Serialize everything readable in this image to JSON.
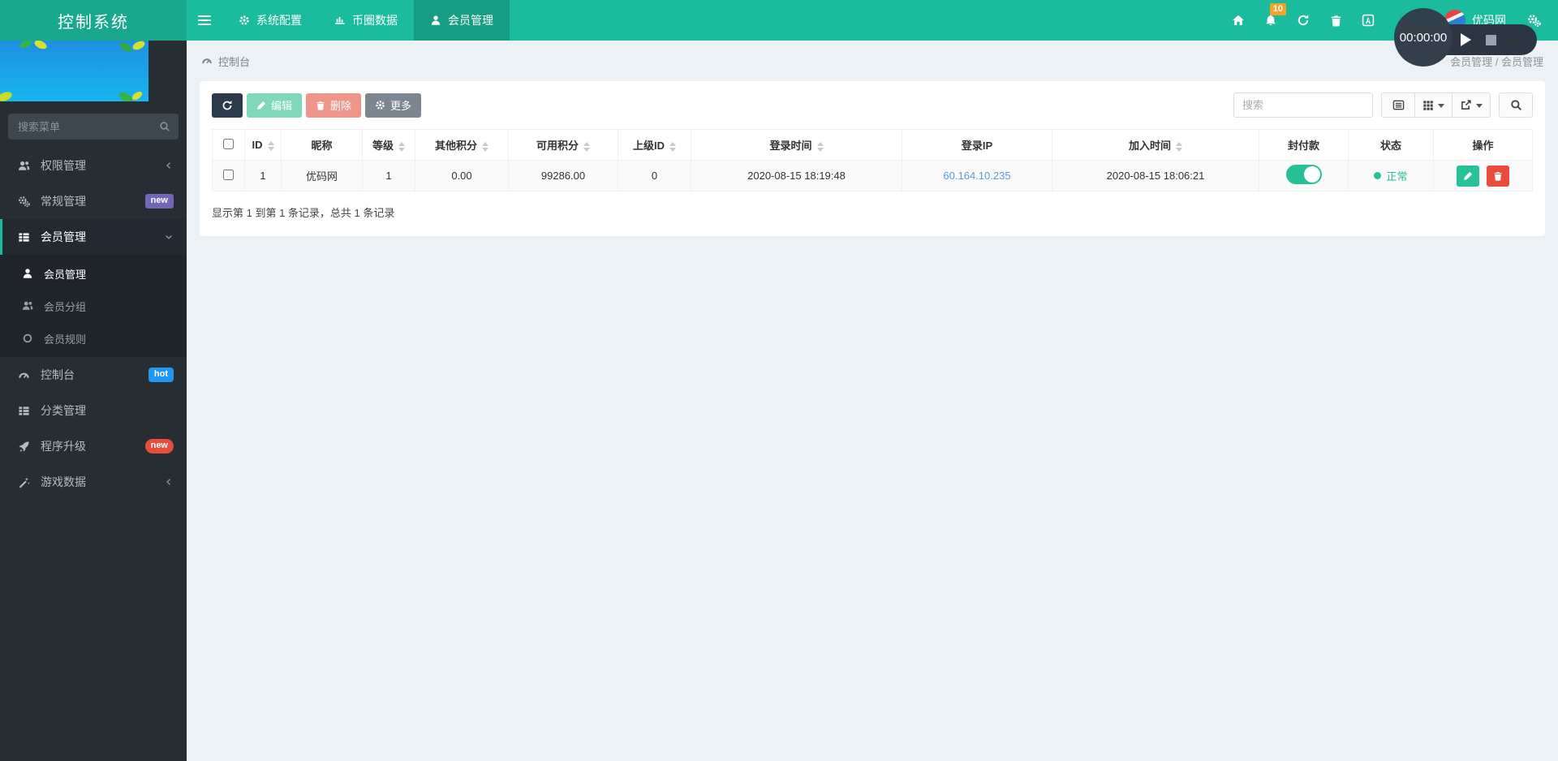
{
  "brand": {
    "title": "控制系统"
  },
  "topbar": {
    "tabs": [
      {
        "label": "系统配置"
      },
      {
        "label": "币圈数据"
      },
      {
        "label": "会员管理"
      }
    ],
    "notification_count": "10",
    "username": "优码网"
  },
  "sidebar": {
    "search_placeholder": "搜索菜单",
    "items": [
      {
        "label": "权限管理"
      },
      {
        "label": "常规管理",
        "badge": {
          "text": "new"
        }
      },
      {
        "label": "会员管理",
        "children": [
          {
            "label": "会员管理"
          },
          {
            "label": "会员分组"
          },
          {
            "label": "会员规则"
          }
        ]
      },
      {
        "label": "控制台",
        "badge": {
          "text": "hot"
        }
      },
      {
        "label": "分类管理"
      },
      {
        "label": "程序升级",
        "badge": {
          "text": "new"
        }
      },
      {
        "label": "游戏数据"
      }
    ]
  },
  "breadcrumb": {
    "left": "控制台",
    "right": "会员管理 / 会员管理"
  },
  "toolbar": {
    "edit_label": "编辑",
    "delete_label": "删除",
    "more_label": "更多",
    "search_placeholder": "搜索"
  },
  "table": {
    "columns": [
      "ID",
      "昵称",
      "等级",
      "其他积分",
      "可用积分",
      "上级ID",
      "登录时间",
      "登录IP",
      "加入时间",
      "封付款",
      "状态",
      "操作"
    ],
    "row": {
      "id": "1",
      "nickname": "优码网",
      "level": "1",
      "other_points": "0.00",
      "available_points": "99286.00",
      "parent_id": "0",
      "login_time": "2020-08-15 18:19:48",
      "login_ip": "60.164.10.235",
      "join_time": "2020-08-15 18:06:21",
      "status": "正常"
    },
    "summary": "显示第 1 到第 1 条记录，总共 1 条记录"
  },
  "recorder": {
    "time": "00:00:00"
  },
  "colors": {
    "navbar_teal": "#1bbc9e",
    "brand_teal": "#18a88b",
    "active_tab_teal": "#169d82",
    "sidebar_dark": "#262d33",
    "submenu_dark": "#1f252a",
    "badge_purple": "#7266ba",
    "badge_blue": "#2196f3",
    "badge_red": "#e74c3c",
    "notification_orange": "#f7a227",
    "btn_dark": "#2b3a4d",
    "btn_edit_green": "#7fd7bc",
    "btn_delete_red": "#f0958a",
    "btn_more_gray": "#7b8691",
    "action_green": "#26c196",
    "action_red": "#e74c3c",
    "link_blue": "#5a9bd3",
    "status_green": "#26c196",
    "content_bg": "#ecf1f5",
    "recorder_dark": "#2b3642"
  }
}
